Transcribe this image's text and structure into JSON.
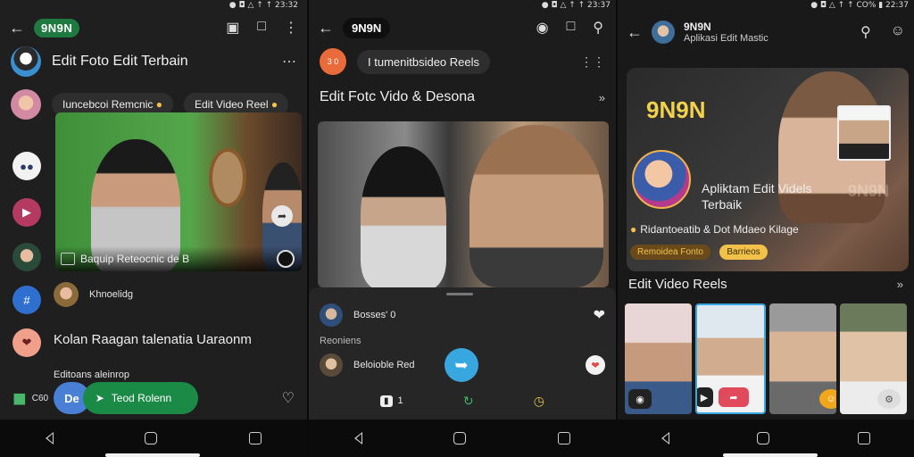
{
  "status_bar": {
    "left_screen": "● ◘ △ ↑ ↑ 23:32",
    "middle_screen": "● ◘ △ ↑ ↑ 23:37",
    "right_screen": "● ◘ △ ↑ ↑ CO% ▮ 22:37"
  },
  "screen1": {
    "logo": "9N9N",
    "chat_title": "Edit Foto Edit Terbain",
    "chip_1": "Iuncebcoi Remcnic",
    "chip_2": "Edit Video Reel",
    "photo_caption": "Baquip Reteocnic de B",
    "row_name": "Khnoelidg",
    "headline": "Kolan Raagan talenatia Uaraonm",
    "subline": "Editoans aleinrop",
    "small_text": "C60",
    "pill_blue": "De",
    "pill_green": "Teod Rolenn"
  },
  "screen2": {
    "logo": "9N9N",
    "search_chip": "I tumenitbsideo Reels",
    "avatar_label": "3 0",
    "section_title": "Edit Fotc Vido & Desona",
    "row_1": "Bosses' 0",
    "row_2": "Reoniens",
    "row_3": "Beloioble Red",
    "bottom_counter": "1"
  },
  "screen3": {
    "header_title": "9N9N",
    "header_sub": "Aplikasi Edit Mastic",
    "brand": "9N9N",
    "profile_line_1": "Apliktam Edit Videls",
    "profile_line_2": "Terbaik",
    "desc": "Ridantoeatib & Dot Mdaeo Kilage",
    "tag_1": "Remoidea Fonto",
    "tag_2": "Barrieos",
    "section_title": "Edit Video Reels",
    "faint_text": "9N9N"
  },
  "colors": {
    "green_accent": "#1c8a47",
    "blue_accent": "#4a7fd6",
    "yellow_brand": "#f2d24a",
    "fab_blue": "#38a7e0"
  }
}
